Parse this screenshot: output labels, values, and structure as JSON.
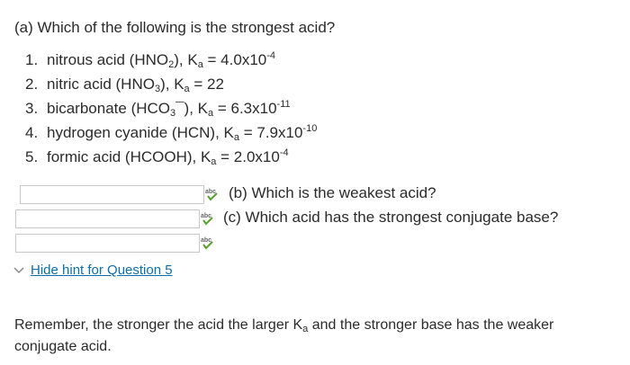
{
  "question": {
    "title": "(a) Which of the following is the strongest acid?",
    "options": [
      {
        "num": "1.",
        "name": "nitrous acid (HNO",
        "sub": "2",
        "tail": "), K",
        "ka_sub": "a",
        "eq": " = 4.0x10",
        "exp": "-4"
      },
      {
        "num": "2.",
        "name": "nitric acid (HNO",
        "sub": "3",
        "tail": "), K",
        "ka_sub": "a",
        "eq": " = 22",
        "exp": ""
      },
      {
        "num": "3.",
        "name": "bicarbonate (HCO",
        "sub": "3",
        "tail": "¯), K",
        "ka_sub": "a",
        "eq": " = 6.3x10",
        "exp": "-11"
      },
      {
        "num": "4.",
        "name": "hydrogen cyanide (HCN), K",
        "sub": "",
        "tail": "",
        "ka_sub": "a",
        "eq": " = 7.9x10",
        "exp": "-10"
      },
      {
        "num": "5.",
        "name": "formic acid (HCOOH), K",
        "sub": "",
        "tail": "",
        "ka_sub": "a",
        "eq": " = 2.0x10",
        "exp": "-4"
      }
    ]
  },
  "answers": {
    "a_value": "",
    "b_value": "",
    "c_value": ""
  },
  "subquestions": {
    "b": "(b)  Which is the weakest acid?",
    "c": "(c)  Which acid has the strongest conjugate base?"
  },
  "spellcheck_icon": {
    "label": "abc",
    "name": "spellcheck-icon",
    "check_color": "#5a9e2f"
  },
  "hint": {
    "toggle_label": "Hide hint for Question 5",
    "text_before": "Remember, the stronger the acid the larger K",
    "text_sub": "a",
    "text_after": " and the stronger base has the weaker conjugate acid."
  },
  "colors": {
    "link": "#0b6ea8",
    "input_border": "#c8c8c8"
  }
}
